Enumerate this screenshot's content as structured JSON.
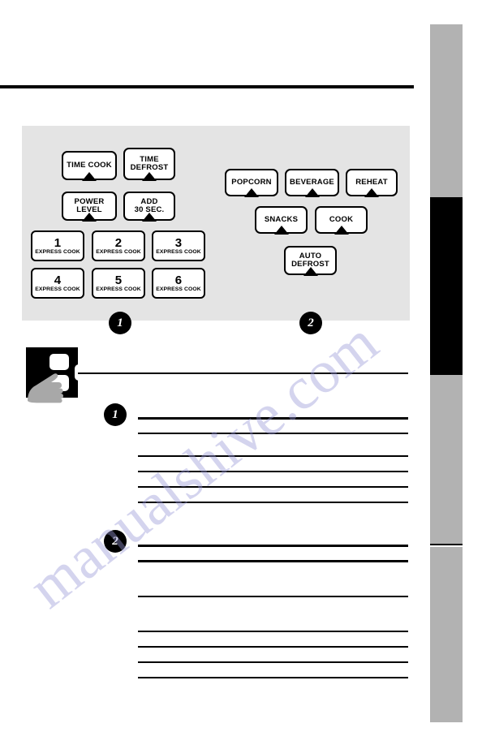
{
  "page": {
    "background_color": "#ffffff",
    "panel_color": "#e4e4e4",
    "accent_color": "#000000",
    "edge_tab_gray": "#b2b2b2",
    "watermark_text": "manualshive.com"
  },
  "control_panel": {
    "group_one": {
      "bullet": "1",
      "keys": [
        {
          "name": "time-cook",
          "lines": [
            "TIME COOK"
          ],
          "notched": true,
          "style": "text"
        },
        {
          "name": "time-defrost",
          "lines": [
            "TIME",
            "DEFROST"
          ],
          "notched": true,
          "style": "text"
        },
        {
          "name": "power-level",
          "lines": [
            "POWER",
            "LEVEL"
          ],
          "notched": true,
          "style": "text"
        },
        {
          "name": "add-30-sec",
          "lines": [
            "ADD",
            "30 SEC."
          ],
          "notched": true,
          "style": "text"
        }
      ],
      "express_keys": [
        {
          "name": "express-cook-1",
          "number": "1",
          "caption": "EXPRESS COOK"
        },
        {
          "name": "express-cook-2",
          "number": "2",
          "caption": "EXPRESS COOK"
        },
        {
          "name": "express-cook-3",
          "number": "3",
          "caption": "EXPRESS COOK"
        },
        {
          "name": "express-cook-4",
          "number": "4",
          "caption": "EXPRESS COOK"
        },
        {
          "name": "express-cook-5",
          "number": "5",
          "caption": "EXPRESS COOK"
        },
        {
          "name": "express-cook-6",
          "number": "6",
          "caption": "EXPRESS COOK"
        }
      ]
    },
    "group_two": {
      "bullet": "2",
      "keys": [
        {
          "name": "popcorn",
          "lines": [
            "POPCORN"
          ],
          "notched": true,
          "style": "text"
        },
        {
          "name": "beverage",
          "lines": [
            "BEVERAGE"
          ],
          "notched": true,
          "style": "text"
        },
        {
          "name": "reheat",
          "lines": [
            "REHEAT"
          ],
          "notched": true,
          "style": "text"
        },
        {
          "name": "snacks",
          "lines": [
            "SNACKS"
          ],
          "notched": true,
          "style": "text"
        },
        {
          "name": "cook",
          "lines": [
            "COOK"
          ],
          "notched": true,
          "style": "text"
        },
        {
          "name": "auto-defrost",
          "lines": [
            "AUTO",
            "DEFROST"
          ],
          "notched": true,
          "style": "text"
        }
      ]
    }
  },
  "body_section": {
    "press_icon_label": "press-keypad-hand-icon",
    "entries": [
      {
        "bullet": "1"
      },
      {
        "bullet": "2"
      }
    ]
  },
  "keys_text": {
    "time_cook": "TIME COOK",
    "time_defrost_l1": "TIME",
    "time_defrost_l2": "DEFROST",
    "power_level_l1": "POWER",
    "power_level_l2": "LEVEL",
    "add_30_sec_l1": "ADD",
    "add_30_sec_l2": "30 SEC.",
    "popcorn": "POPCORN",
    "beverage": "BEVERAGE",
    "reheat": "REHEAT",
    "snacks": "SNACKS",
    "cook": "COOK",
    "auto_defrost_l1": "AUTO",
    "auto_defrost_l2": "DEFROST",
    "express_caption": "EXPRESS COOK",
    "n1": "1",
    "n2": "2",
    "n3": "3",
    "n4": "4",
    "n5": "5",
    "n6": "6"
  },
  "bullets": {
    "panel_one": "1",
    "panel_two": "2",
    "body_one": "1",
    "body_two": "2"
  }
}
